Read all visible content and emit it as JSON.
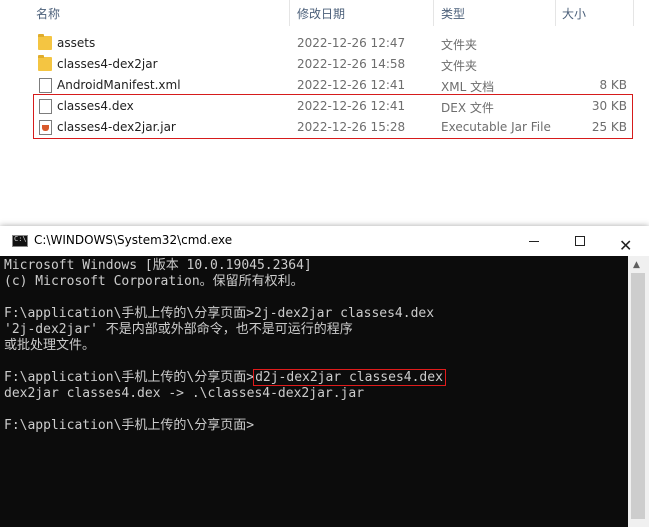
{
  "explorer": {
    "columns": {
      "name": "名称",
      "date": "修改日期",
      "type": "类型",
      "size": "大小"
    },
    "files": [
      {
        "name": "assets",
        "date": "2022-12-26 12:47",
        "type": "文件夹",
        "size": "",
        "icon": "folder-icon"
      },
      {
        "name": "classes4-dex2jar",
        "date": "2022-12-26 14:58",
        "type": "文件夹",
        "size": "",
        "icon": "folder-icon"
      },
      {
        "name": "AndroidManifest.xml",
        "date": "2022-12-26 12:41",
        "type": "XML 文档",
        "size": "8 KB",
        "icon": "document-icon"
      },
      {
        "name": "classes4.dex",
        "date": "2022-12-26 12:41",
        "type": "DEX 文件",
        "size": "30 KB",
        "icon": "document-icon"
      },
      {
        "name": "classes4-dex2jar.jar",
        "date": "2022-12-26 15:28",
        "type": "Executable Jar File",
        "size": "25 KB",
        "icon": "jar-file-icon"
      }
    ]
  },
  "cmd": {
    "title": "C:\\WINDOWS\\System32\\cmd.exe",
    "lines": [
      "Microsoft Windows [版本 10.0.19045.2364]",
      "(c) Microsoft Corporation。保留所有权利。",
      "",
      "F:\\application\\手机上传的\\分享页面>2j-dex2jar classes4.dex",
      "'2j-dex2jar' 不是内部或外部命令，也不是可运行的程序",
      "或批处理文件。",
      "",
      "F:\\application\\手机上传的\\分享页面>",
      "dex2jar classes4.dex -> .\\classes4-dex2jar.jar",
      "",
      "F:\\application\\手机上传的\\分享页面>"
    ],
    "highlighted_command": "d2j-dex2jar classes4.dex"
  },
  "colors": {
    "highlight": "#d61b1b",
    "console_bg": "#0c0c0c",
    "console_text": "#cccccc",
    "folder": "#f4c542"
  }
}
